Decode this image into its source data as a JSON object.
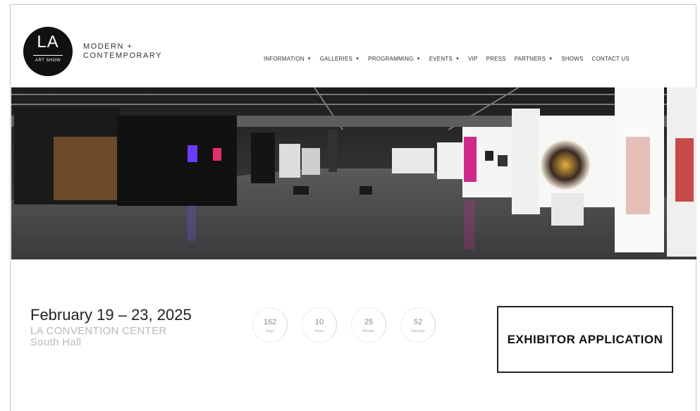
{
  "logo": {
    "main": "LA",
    "sub": "ART SHOW"
  },
  "tagline": {
    "line1": "MODERN +",
    "line2": "CONTEMPORARY"
  },
  "nav": [
    {
      "label": "INFORMATION",
      "dropdown": true
    },
    {
      "label": "GALLERIES",
      "dropdown": true
    },
    {
      "label": "PROGRAMMING",
      "dropdown": true
    },
    {
      "label": "EVENTS",
      "dropdown": true
    },
    {
      "label": "VIP",
      "dropdown": false
    },
    {
      "label": "PRESS",
      "dropdown": false
    },
    {
      "label": "PARTNERS",
      "dropdown": true
    },
    {
      "label": "SHOWS",
      "dropdown": false
    },
    {
      "label": "CONTACT US",
      "dropdown": false
    }
  ],
  "event": {
    "date": "February 19 – 23, 2025",
    "venue_line1": "LA CONVENTION CENTER",
    "venue_line2": "South Hall"
  },
  "countdown": [
    {
      "value": "162",
      "label": "Days"
    },
    {
      "value": "10",
      "label": "Hours"
    },
    {
      "value": "25",
      "label": "Minutes"
    },
    {
      "value": "52",
      "label": "Seconds"
    }
  ],
  "cta": {
    "label": "EXHIBITOR APPLICATION"
  },
  "colors": {
    "text": "#222222",
    "muted": "#b9b9b9",
    "logo_bg": "#111111"
  }
}
